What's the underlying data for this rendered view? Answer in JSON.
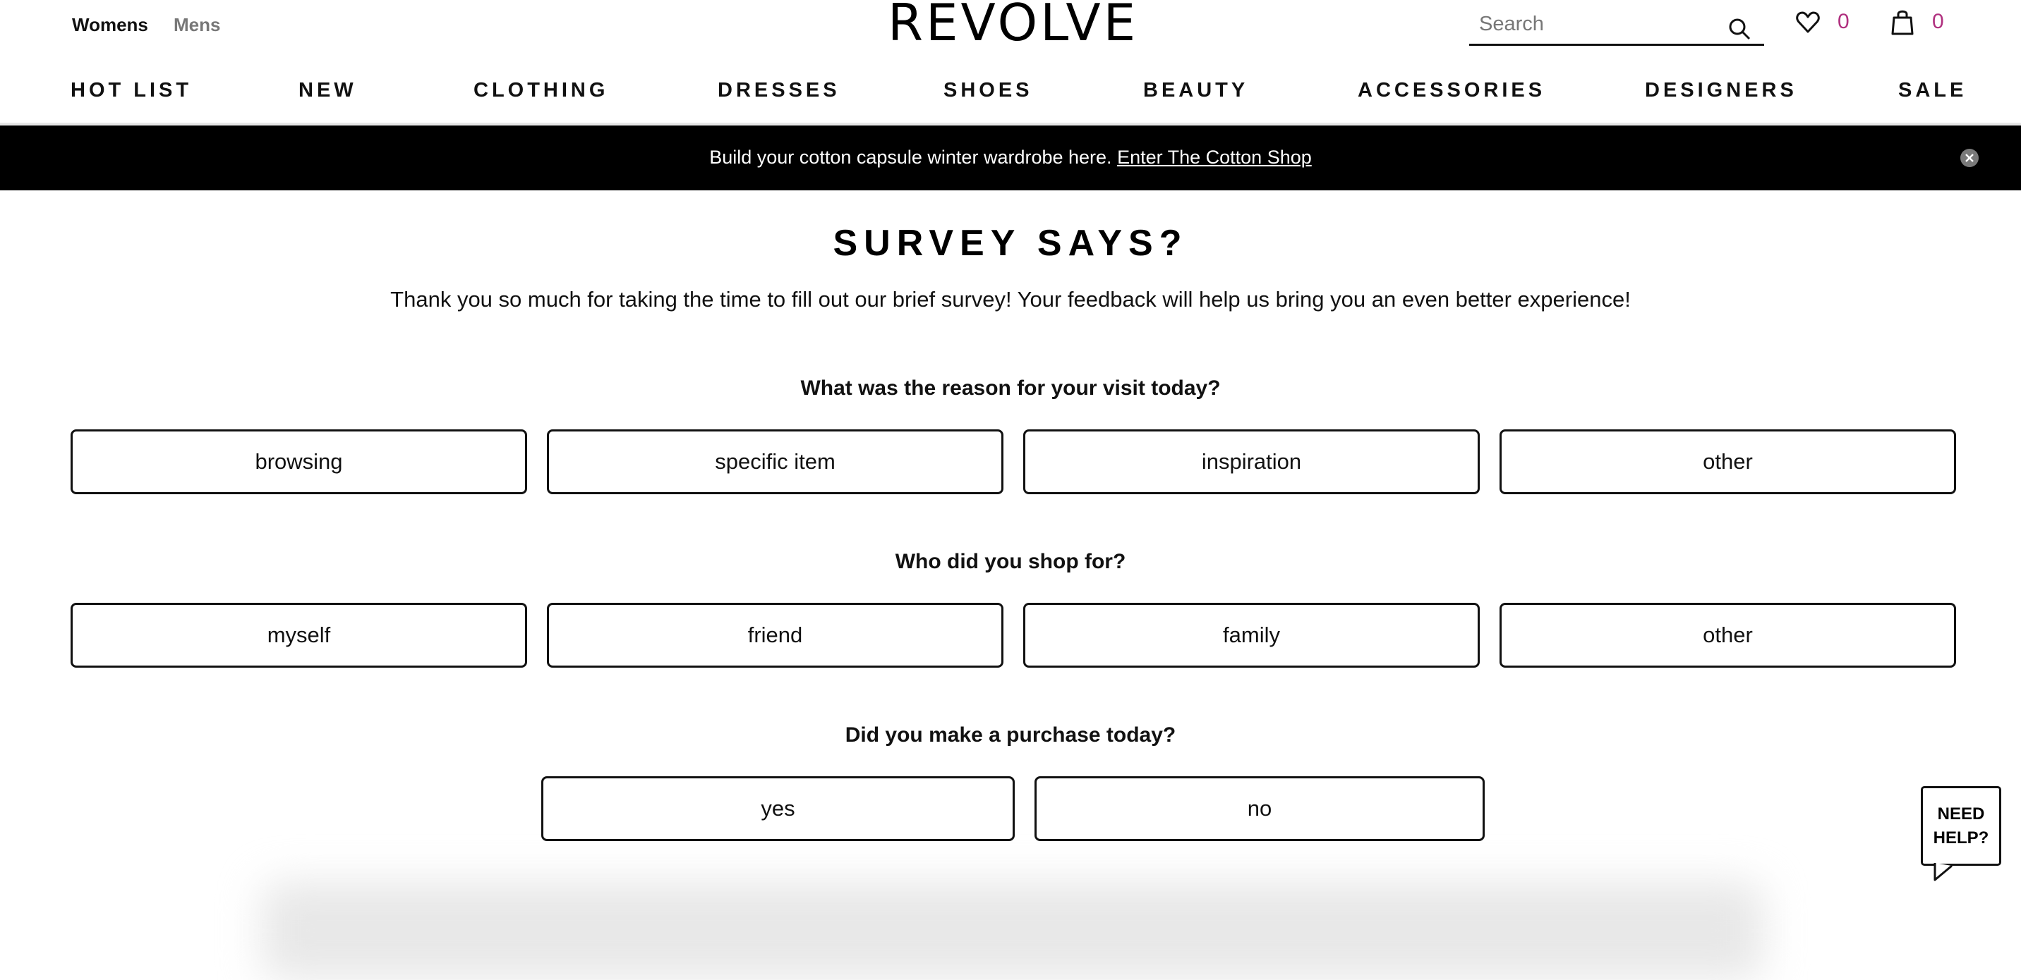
{
  "header": {
    "gender_tabs": [
      {
        "label": "Womens",
        "active": true
      },
      {
        "label": "Mens",
        "active": false
      }
    ],
    "logo": "REVOLVE",
    "search": {
      "placeholder": "Search",
      "value": "",
      "icon": "search-icon"
    },
    "wishlist": {
      "icon": "heart-icon",
      "count": "0"
    },
    "bag": {
      "icon": "shopping-bag-icon",
      "count": "0"
    },
    "accent_color": "#b0307f"
  },
  "nav": {
    "items": [
      "HOT LIST",
      "NEW",
      "CLOTHING",
      "DRESSES",
      "SHOES",
      "BEAUTY",
      "ACCESSORIES",
      "DESIGNERS",
      "SALE"
    ]
  },
  "banner": {
    "text": "Build your cotton capsule winter wardrobe here.",
    "link_label": "Enter The Cotton Shop",
    "close_icon": "close-icon"
  },
  "survey": {
    "title": "SURVEY SAYS?",
    "subtitle": "Thank you so much for taking the time to fill out our brief survey! Your feedback will help us bring you an even better experience!",
    "questions": [
      {
        "question": "What was the reason for your visit today?",
        "options": [
          "browsing",
          "specific item",
          "inspiration",
          "other"
        ]
      },
      {
        "question": "Who did you shop for?",
        "options": [
          "myself",
          "friend",
          "family",
          "other"
        ]
      },
      {
        "question": "Did you make a purchase today?",
        "options": [
          "yes",
          "no"
        ]
      }
    ]
  },
  "help_widget": {
    "line1": "NEED",
    "line2": "HELP?"
  }
}
